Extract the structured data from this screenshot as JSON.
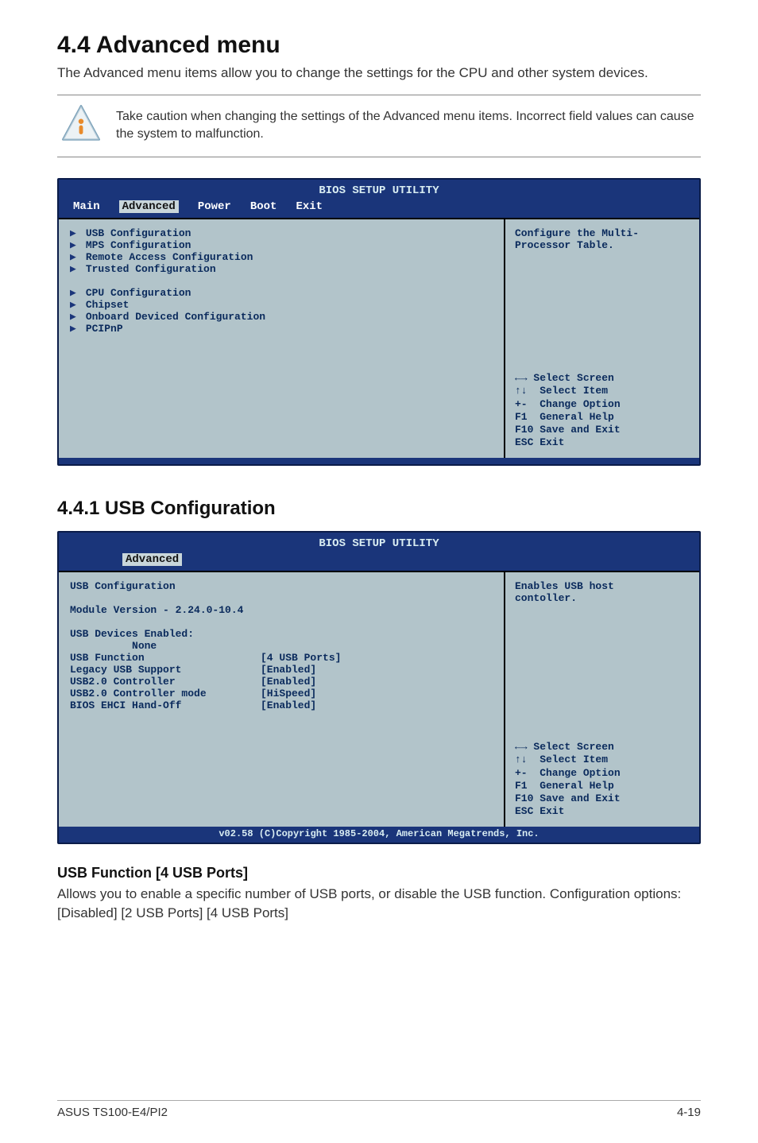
{
  "section": {
    "title": "4.4 Advanced menu",
    "intro": "The Advanced menu items allow you to change the settings for the CPU and other system devices.",
    "callout": "Take caution when changing the settings of the Advanced menu items. Incorrect field values can cause the system to malfunction."
  },
  "bios_main": {
    "util_title": "BIOS SETUP UTILITY",
    "tabs": {
      "main": "Main",
      "advanced": "Advanced",
      "power": "Power",
      "boot": "Boot",
      "exit": "Exit"
    },
    "items": {
      "usb_cfg": "USB Configuration",
      "mps_cfg": "MPS Configuration",
      "remote_cfg": "Remote Access Configuration",
      "trusted_cfg": "Trusted Configuration",
      "cpu_cfg": "CPU Configuration",
      "chipset": "Chipset",
      "onboard_cfg": "Onboard Deviced Configuration",
      "pcipnp": "PCIPnP"
    },
    "help_top": "Configure the Multi-\nProcessor Table.",
    "keys": "←→ Select Screen\n↑↓  Select Item\n+-  Change Option\nF1  General Help\nF10 Save and Exit\nESC Exit"
  },
  "subsection": {
    "title": "4.4.1 USB Configuration"
  },
  "bios_usb": {
    "util_title": "BIOS SETUP UTILITY",
    "tab_advanced": "Advanced",
    "heading": "USB Configuration",
    "module_version": "Module Version - 2.24.0-10.4",
    "devices_heading": "USB Devices Enabled:",
    "devices_none": "          None",
    "rows": {
      "usb_function": {
        "label": "USB Function",
        "val": "[4 USB Ports]"
      },
      "legacy": {
        "label": "Legacy USB Support",
        "val": "[Enabled]"
      },
      "usb20ctrl": {
        "label": "USB2.0 Controller",
        "val": "[Enabled]"
      },
      "usb20mode": {
        "label": "USB2.0 Controller mode",
        "val": "[HiSpeed]"
      },
      "ehci": {
        "label": "BIOS EHCI Hand-Off",
        "val": "[Enabled]"
      }
    },
    "help_top": "Enables USB host\ncontoller.",
    "keys": "←→ Select Screen\n↑↓  Select Item\n+-  Change Option\nF1  General Help\nF10 Save and Exit\nESC Exit",
    "footer": "v02.58 (C)Copyright 1985-2004, American Megatrends, Inc."
  },
  "param": {
    "title": "USB Function [4 USB Ports]",
    "desc": "Allows you to enable a specific number of USB ports, or disable the USB function. Configuration options: [Disabled] [2 USB Ports] [4 USB Ports]"
  },
  "footer": {
    "left": "ASUS TS100-E4/PI2",
    "right": "4-19"
  }
}
